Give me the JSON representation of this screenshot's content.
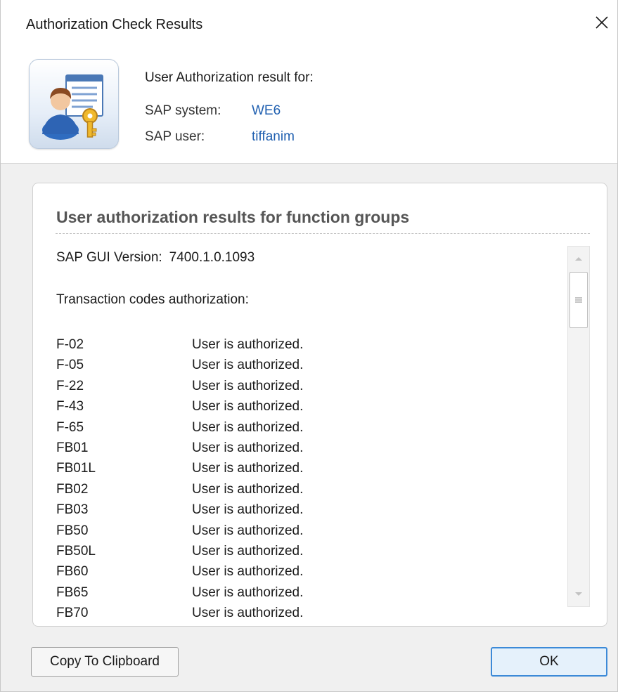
{
  "window": {
    "title": "Authorization Check Results"
  },
  "header": {
    "heading": "User Authorization result for:",
    "system_label": "SAP system:",
    "system_value": "WE6",
    "user_label": "SAP user:",
    "user_value": "tiffanim"
  },
  "panel": {
    "title": "User authorization results for function groups",
    "gui_version_label": "SAP GUI Version:",
    "gui_version_value": "7400.1.0.1093",
    "transactions_heading": "Transaction codes authorization:",
    "transactions": [
      {
        "code": "F-02",
        "status": "User is authorized."
      },
      {
        "code": "F-05",
        "status": "User is authorized."
      },
      {
        "code": "F-22",
        "status": "User is authorized."
      },
      {
        "code": "F-43",
        "status": "User is authorized."
      },
      {
        "code": "F-65",
        "status": "User is authorized."
      },
      {
        "code": "FB01",
        "status": "User is authorized."
      },
      {
        "code": "FB01L",
        "status": "User is authorized."
      },
      {
        "code": "FB02",
        "status": "User is authorized."
      },
      {
        "code": "FB03",
        "status": "User is authorized."
      },
      {
        "code": "FB50",
        "status": "User is authorized."
      },
      {
        "code": "FB50L",
        "status": "User is authorized."
      },
      {
        "code": "FB60",
        "status": "User is authorized."
      },
      {
        "code": "FB65",
        "status": "User is authorized."
      },
      {
        "code": "FB70",
        "status": "User is authorized."
      }
    ]
  },
  "buttons": {
    "copy_label": "Copy To Clipboard",
    "ok_label": "OK"
  },
  "icons": {
    "close": "close-icon",
    "app": "user-key-icon",
    "scroll_up": "scroll-up-arrow-icon",
    "scroll_down": "scroll-down-arrow-icon",
    "scroll_grip": "scroll-grip-icon"
  },
  "colors": {
    "link_value": "#1f5fb0",
    "ok_border": "#3c8ad8",
    "ok_fill": "#e5f1fb"
  }
}
